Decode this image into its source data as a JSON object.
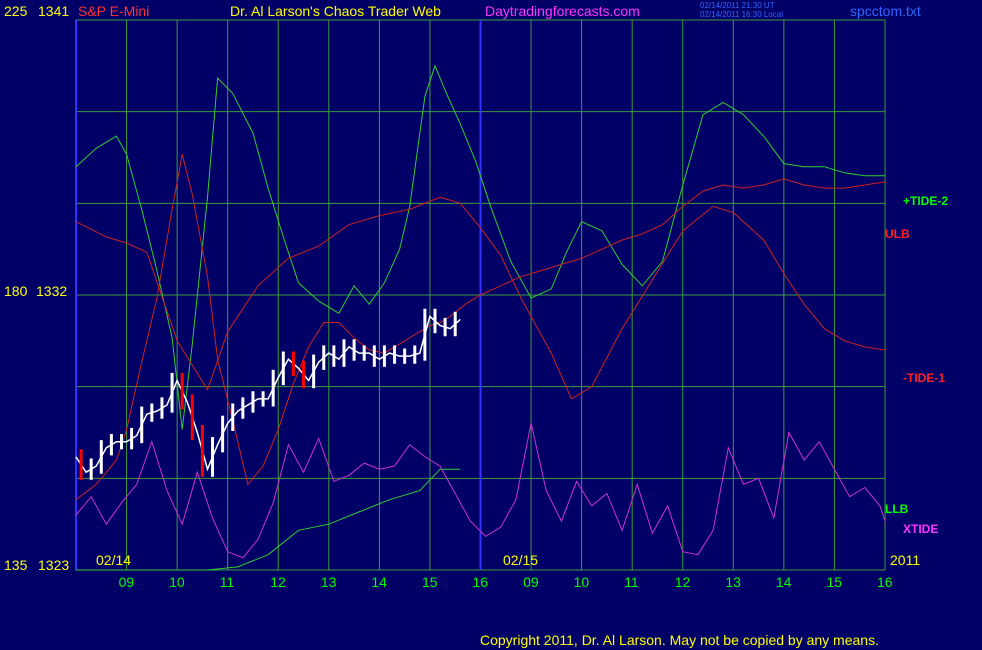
{
  "header": {
    "symbol": "S&P E-Mini",
    "title": "Dr. Al Larson's Chaos Trader Web",
    "site": "Daytradingforecasts.com",
    "timestamp_ut": "02/14/2011 21:30 UT",
    "timestamp_local": "02/14/2011 16:30 Local",
    "file": "spcctom.txt"
  },
  "left_axis": {
    "top_left": "225",
    "top_right": "1341",
    "mid_left": "180",
    "mid_right": "1332",
    "bottom_left": "135",
    "bottom_right": "1323"
  },
  "date_labels": [
    "02/14",
    "02/15"
  ],
  "year_label": "2011",
  "hour_labels": [
    "09",
    "10",
    "11",
    "12",
    "13",
    "14",
    "15",
    "16",
    "09",
    "10",
    "11",
    "12",
    "13",
    "14",
    "15",
    "16"
  ],
  "right_labels": {
    "tide2": "+TIDE-2",
    "ulb": "ULB",
    "tide1": "-TIDE-1",
    "llb": "LLB",
    "xtide": "XTIDE"
  },
  "copyright": "Copyright 2011, Dr. Al Larson. May not be copied by any means.",
  "colors": {
    "background": "#000066",
    "plot_bg": "#000066",
    "grid": "#3c9c3c",
    "divider": "#3333ff",
    "tide2": "#33cc33",
    "tide1": "#cc2222",
    "llb": "#33cc33",
    "xtide": "#cc33cc",
    "price": "#ffffff",
    "label_yellow": "#ffff00",
    "label_green": "#00ff00",
    "label_red": "#ff2222",
    "label_magenta": "#ff33ff",
    "label_blue": "#3366ff"
  },
  "chart_data": {
    "type": "line",
    "x_unit": "trading hour index (0 = 02/14 08:30 session start, 16 = end of 02/15 session)",
    "ylim": [
      1323,
      1341
    ],
    "y_ticks": [
      1323,
      1332,
      1341
    ],
    "series": [
      {
        "name": "+TIDE-2",
        "x": [
          0,
          0.4,
          0.8,
          1.0,
          1.3,
          1.6,
          1.9,
          2.1,
          2.3,
          2.6,
          2.8,
          3.1,
          3.5,
          3.8,
          4.1,
          4.4,
          4.8,
          5.2,
          5.5,
          5.8,
          6.1,
          6.4,
          6.6,
          6.9,
          7.1,
          7.3,
          7.6,
          7.9,
          8.2,
          8.6,
          9.0,
          9.4,
          9.7,
          10.0,
          10.4,
          10.8,
          11.2,
          11.6,
          12.0,
          12.4,
          12.8,
          13.2,
          13.6,
          14.0,
          14.4,
          14.8,
          15.2,
          15.6,
          16.0
        ],
        "values": [
          1336.2,
          1336.8,
          1337.2,
          1336.6,
          1334.8,
          1332.8,
          1330.6,
          1327.6,
          1330.4,
          1335.2,
          1339.1,
          1338.6,
          1337.3,
          1335.5,
          1333.9,
          1332.4,
          1331.8,
          1331.4,
          1332.3,
          1331.7,
          1332.4,
          1333.5,
          1334.9,
          1338.5,
          1339.5,
          1338.7,
          1337.6,
          1336.4,
          1334.9,
          1333.1,
          1331.9,
          1332.2,
          1333.4,
          1334.4,
          1334.1,
          1333.0,
          1332.3,
          1333.1,
          1335.6,
          1337.9,
          1338.3,
          1337.9,
          1337.2,
          1336.3,
          1336.2,
          1336.2,
          1336.0,
          1335.9,
          1335.9
        ]
      },
      {
        "name": "-TIDE-1",
        "x": [
          0,
          0.4,
          0.8,
          1.0,
          1.3,
          1.6,
          1.9,
          2.1,
          2.3,
          2.6,
          2.8,
          3.1,
          3.4,
          3.7,
          4.0,
          4.3,
          4.6,
          4.9,
          5.2,
          5.5,
          5.8,
          6.1,
          6.4,
          6.7,
          7.0,
          7.2,
          7.4,
          7.7,
          8.0,
          8.4,
          8.8,
          9.2,
          9.6,
          10.0,
          10.4,
          10.8,
          11.2,
          11.6,
          12.0,
          12.4,
          12.8,
          13.2,
          13.6,
          14.0,
          14.4,
          14.8,
          15.2,
          15.6,
          16.0
        ],
        "values": [
          1325.3,
          1325.8,
          1326.6,
          1327.6,
          1329.8,
          1331.9,
          1334.8,
          1336.6,
          1335.3,
          1332.6,
          1329.9,
          1327.9,
          1325.8,
          1326.4,
          1327.6,
          1329.1,
          1330.3,
          1331.1,
          1331.1,
          1330.6,
          1330.2,
          1330.1,
          1330.4,
          1330.7,
          1331.0,
          1331.1,
          1331.3,
          1331.7,
          1332.0,
          1332.3,
          1332.6,
          1332.8,
          1333.0,
          1333.2,
          1333.5,
          1333.8,
          1334.0,
          1334.3,
          1334.9,
          1335.4,
          1335.6,
          1335.5,
          1335.6,
          1335.8,
          1335.6,
          1335.5,
          1335.5,
          1335.6,
          1335.7
        ]
      },
      {
        "name": "ULB",
        "x": [
          0,
          0.6,
          1.0,
          1.4,
          2.0,
          2.6,
          3.0,
          3.6,
          4.2,
          4.8,
          5.4,
          6.0,
          6.6,
          7.2,
          7.6,
          8.0,
          8.4,
          8.8,
          9.4,
          9.8,
          10.2,
          10.8,
          11.4,
          12.0,
          12.6,
          13.0,
          13.6,
          14.0,
          14.4,
          14.8,
          15.2,
          15.6,
          16.0
        ],
        "values": [
          1334.4,
          1333.9,
          1333.7,
          1333.4,
          1330.5,
          1328.9,
          1330.8,
          1332.3,
          1333.2,
          1333.6,
          1334.3,
          1334.6,
          1334.8,
          1335.2,
          1335.0,
          1334.2,
          1333.3,
          1331.9,
          1330.1,
          1328.6,
          1329.0,
          1330.9,
          1332.5,
          1334.1,
          1334.9,
          1334.7,
          1333.8,
          1332.7,
          1331.7,
          1330.9,
          1330.5,
          1330.3,
          1330.2
        ]
      },
      {
        "name": "LLB",
        "x": [
          0,
          0.5,
          1.0,
          1.5,
          2.0,
          2.6,
          3.2,
          3.8,
          4.4,
          5.0,
          5.6,
          6.2,
          6.8,
          7.2,
          7.6
        ],
        "values": [
          1323.0,
          1323.0,
          1323.0,
          1323.0,
          1323.0,
          1323.0,
          1323.1,
          1323.5,
          1324.3,
          1324.5,
          1324.9,
          1325.3,
          1325.6,
          1326.3,
          1326.3
        ]
      },
      {
        "name": "XTIDE",
        "x": [
          0,
          0.3,
          0.6,
          0.9,
          1.2,
          1.5,
          1.8,
          2.1,
          2.4,
          2.7,
          3.0,
          3.3,
          3.6,
          3.9,
          4.2,
          4.5,
          4.8,
          5.1,
          5.4,
          5.7,
          6.0,
          6.3,
          6.6,
          6.9,
          7.2,
          7.5,
          7.8,
          8.1,
          8.4,
          8.7,
          9.0,
          9.3,
          9.6,
          9.9,
          10.2,
          10.5,
          10.8,
          11.1,
          11.4,
          11.7,
          12.0,
          12.3,
          12.6,
          12.9,
          13.2,
          13.5,
          13.8,
          14.1,
          14.4,
          14.7,
          15.0,
          15.3,
          15.6,
          15.9,
          16.0
        ],
        "values": [
          1324.8,
          1325.4,
          1324.5,
          1325.2,
          1325.8,
          1327.2,
          1325.6,
          1324.5,
          1326.2,
          1324.7,
          1323.6,
          1323.4,
          1324.0,
          1325.2,
          1327.1,
          1326.2,
          1327.3,
          1325.9,
          1326.1,
          1326.5,
          1326.3,
          1326.4,
          1327.1,
          1326.7,
          1326.4,
          1325.5,
          1324.6,
          1324.1,
          1324.4,
          1325.3,
          1327.8,
          1325.6,
          1324.6,
          1325.9,
          1325.1,
          1325.5,
          1324.3,
          1325.8,
          1324.2,
          1325.1,
          1323.6,
          1323.5,
          1324.3,
          1327.0,
          1325.8,
          1326.0,
          1324.7,
          1327.5,
          1326.6,
          1327.2,
          1326.3,
          1325.4,
          1325.7,
          1325.1,
          1324.6
        ]
      },
      {
        "name": "Price",
        "x": [
          0,
          0.2,
          0.4,
          0.6,
          0.8,
          1.0,
          1.2,
          1.4,
          1.6,
          1.8,
          2.0,
          2.2,
          2.4,
          2.6,
          2.8,
          3.0,
          3.2,
          3.4,
          3.6,
          3.8,
          4.0,
          4.2,
          4.4,
          4.6,
          4.8,
          5.0,
          5.2,
          5.4,
          5.6,
          5.8,
          6.0,
          6.2,
          6.4,
          6.6,
          6.8,
          7.0,
          7.2,
          7.4,
          7.6
        ],
        "values": [
          1326.7,
          1326.2,
          1326.4,
          1327.0,
          1327.2,
          1327.2,
          1327.4,
          1328.1,
          1328.2,
          1328.4,
          1329.2,
          1328.5,
          1327.5,
          1326.3,
          1327.1,
          1327.8,
          1328.2,
          1328.4,
          1328.6,
          1328.6,
          1329.3,
          1329.9,
          1329.6,
          1329.2,
          1329.8,
          1330.1,
          1329.9,
          1330.3,
          1330.1,
          1330.1,
          1329.9,
          1330.1,
          1330.0,
          1330.0,
          1330.1,
          1331.3,
          1331.0,
          1330.9,
          1331.2
        ]
      }
    ],
    "grid": true
  }
}
